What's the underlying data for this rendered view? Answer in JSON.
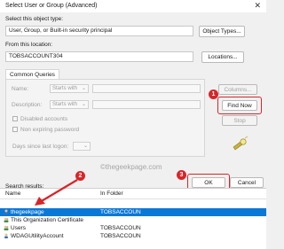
{
  "window": {
    "title": "Select User or Group (Advanced)",
    "close_glyph": "✕"
  },
  "object_type": {
    "label": "Select this object type:",
    "value": "User, Group, or Built-in security principal",
    "button": "Object Types..."
  },
  "location": {
    "label": "From this location:",
    "value": "TOBSACCOUNT304",
    "button": "Locations..."
  },
  "queries": {
    "tab": "Common Queries",
    "name": {
      "label": "Name:",
      "mode": "Starts with"
    },
    "description": {
      "label": "Description:",
      "mode": "Starts with"
    },
    "disabled_accounts": "Disabled accounts",
    "non_expiring": "Non expiring password",
    "days_since": "Days since last logon:"
  },
  "buttons": {
    "columns": "Columns...",
    "find_now": "Find Now",
    "stop": "Stop",
    "ok": "OK",
    "cancel": "Cancel"
  },
  "watermark": "©thegeekpage.com",
  "steps": {
    "one": "1",
    "two": "2",
    "three": "3"
  },
  "results": {
    "label": "Search results:",
    "columns": [
      "Name",
      "In Folder"
    ],
    "rows": [
      {
        "name": "thegeekpage",
        "folder": "TOBSACCOUN",
        "icon": "user-icon",
        "selected": true
      },
      {
        "name": "This Organization Certificate",
        "folder": "",
        "icon": "group-icon",
        "selected": false
      },
      {
        "name": "Users",
        "folder": "TOBSACCOUN",
        "icon": "group-icon",
        "selected": false
      },
      {
        "name": "WDAGUtilityAccount",
        "folder": "TOBSACCOUN",
        "icon": "user-icon",
        "selected": false
      }
    ]
  },
  "accent_colors": {
    "highlight": "#d7252a",
    "selection": "#0a78d7"
  }
}
